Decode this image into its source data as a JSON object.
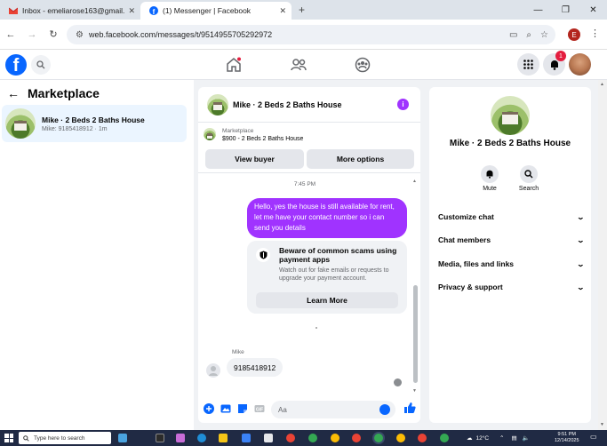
{
  "browser": {
    "tabs": [
      {
        "title": "Inbox - emeliarose163@gmail.c",
        "active": false
      },
      {
        "title": "(1) Messenger | Facebook",
        "active": true
      }
    ],
    "url": "web.facebook.com/messages/t/9514955705292972",
    "profile_initial": "E"
  },
  "fb_header": {
    "notification_count": "1"
  },
  "left": {
    "title": "Marketplace",
    "conversations": [
      {
        "name": "Mike · 2 Beds 2 Baths House",
        "subtitle": "Mike: 9185418912 · 1m"
      }
    ]
  },
  "chat": {
    "title": "Mike · 2 Beds 2 Baths House",
    "marketplace_tag": "Marketplace",
    "listing": "$900 - 2 Beds 2 Baths House",
    "view_buyer": "View buyer",
    "more_options": "More options",
    "timestamp": "7:45 PM",
    "outgoing_message": "Hello, yes the house is still available for rent, let me have your contact number so i can send you  details",
    "scam_title": "Beware of common scams using payment apps",
    "scam_desc": "Watch out for fake emails or requests to upgrade your payment account.",
    "learn_more": "Learn More",
    "sender_name": "Mike",
    "incoming_message": "9185418912",
    "composer_placeholder": "Aa"
  },
  "details": {
    "name": "Mike · 2 Beds 2 Baths House",
    "actions": [
      {
        "label": "Mute"
      },
      {
        "label": "Search"
      }
    ],
    "menu": [
      "Customize chat",
      "Chat members",
      "Media, files and links",
      "Privacy & support"
    ]
  },
  "taskbar": {
    "search_placeholder": "Type here to search",
    "temperature": "12°C",
    "time": "9:51 PM",
    "date": "12/14/2025"
  },
  "colors": {
    "accent": "#a033ff",
    "fb_blue": "#0866ff"
  }
}
